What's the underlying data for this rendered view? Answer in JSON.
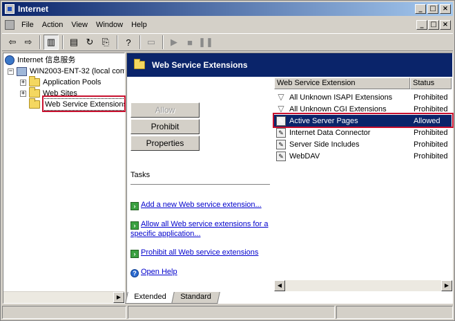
{
  "window": {
    "title": "Internet",
    "min_glyph": "_",
    "max_glyph": "□",
    "close_glyph": "×"
  },
  "menu": [
    "File",
    "Action",
    "View",
    "Window",
    "Help"
  ],
  "toolbar_icons": [
    "back-icon",
    "forward-icon",
    "show-hide-tree-icon",
    "properties-icon",
    "refresh-icon",
    "export-list-icon",
    "help-icon",
    "computer-icon",
    "play-icon",
    "stop-icon",
    "pause-icon"
  ],
  "tree": {
    "root": "Internet 信息服务",
    "server": "WIN2003-ENT-32 (local com",
    "children": [
      "Application Pools",
      "Web Sites",
      "Web Service Extensions"
    ]
  },
  "panel": {
    "header": "Web Service Extensions",
    "buttons": {
      "allow": "Allow",
      "prohibit": "Prohibit",
      "properties": "Properties"
    },
    "tasks_title": "Tasks",
    "tasks": [
      "Add a new Web service extension...",
      "Allow all Web service extensions for a specific application...",
      "Prohibit all Web service extensions",
      "Open Help"
    ]
  },
  "list": {
    "columns": [
      "Web Service Extension",
      "Status"
    ],
    "rows": [
      {
        "name": "All Unknown ISAPI Extensions",
        "status": "Prohibited"
      },
      {
        "name": "All Unknown CGI Extensions",
        "status": "Prohibited"
      },
      {
        "name": "Active Server Pages",
        "status": "Allowed"
      },
      {
        "name": "Internet Data Connector",
        "status": "Prohibited"
      },
      {
        "name": "Server Side Includes",
        "status": "Prohibited"
      },
      {
        "name": "WebDAV",
        "status": "Prohibited"
      }
    ]
  },
  "tabs": [
    "Extended",
    "Standard"
  ],
  "colors": {
    "selection": "#0a246a",
    "highlight_box": "#c8102e",
    "link": "#0000cc"
  }
}
